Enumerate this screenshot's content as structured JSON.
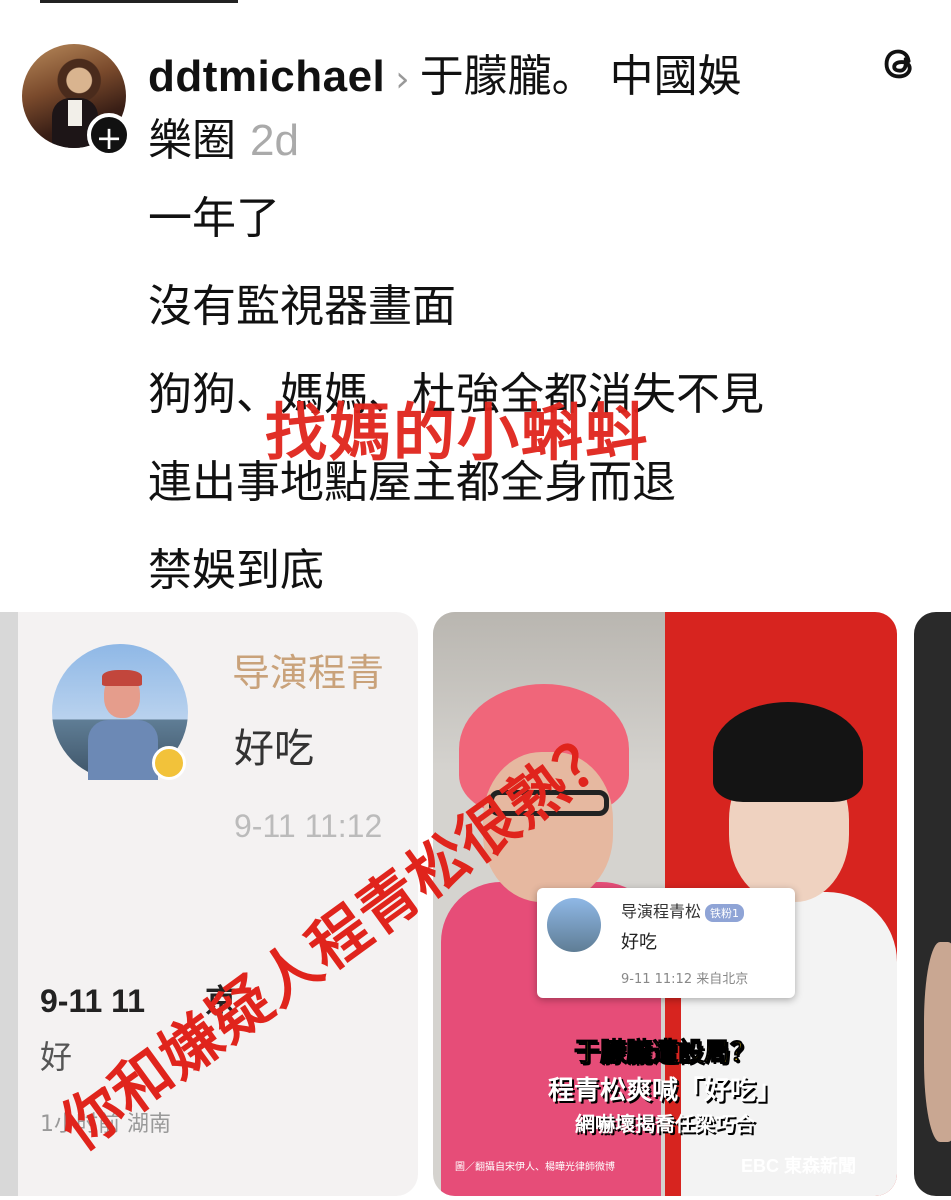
{
  "post": {
    "username": "ddtmichael",
    "community_line1": "于朦朧。 中國娛",
    "community_line2": "樂圈",
    "time_ago": "2d",
    "body": [
      "一年了",
      "沒有監視器畫面",
      "狗狗、媽媽、杜強全都消失不見",
      "連出事地點屋主都全身而退",
      "禁娛到底"
    ]
  },
  "overlay": {
    "red_caption": "找媽的小蝌蚪",
    "diagonal_caption": "你和嫌疑人程青松很熟？"
  },
  "media": {
    "card1": {
      "name": "导演程青",
      "text": "好吃",
      "time": "9-11 11:12",
      "time2": "9-11 11",
      "time2_suffix": "京",
      "snippet": "好",
      "meta": "1小时前 湖南"
    },
    "card2": {
      "weibo_name": "导演程青松",
      "weibo_tag": "铁粉1",
      "weibo_text": "好吃",
      "weibo_time": "9-11 11:12  来自北京",
      "caption1": "于朦朧遭設局？",
      "caption2": "程青松爽喊「好吃」",
      "caption3": "網嚇壞揭喬任梁巧合",
      "credit": "圖／翻攝自宋伊人、楊曄光律師微博",
      "logo": "EBC 東森新聞"
    }
  },
  "colors": {
    "overlay_red": "#e0241c",
    "timestamp_gray": "#aaaaaa",
    "news_red": "#d7241f"
  },
  "icons": {
    "app_logo": "threads-icon",
    "follow": "plus-icon",
    "separator": "chevron-right-icon"
  }
}
